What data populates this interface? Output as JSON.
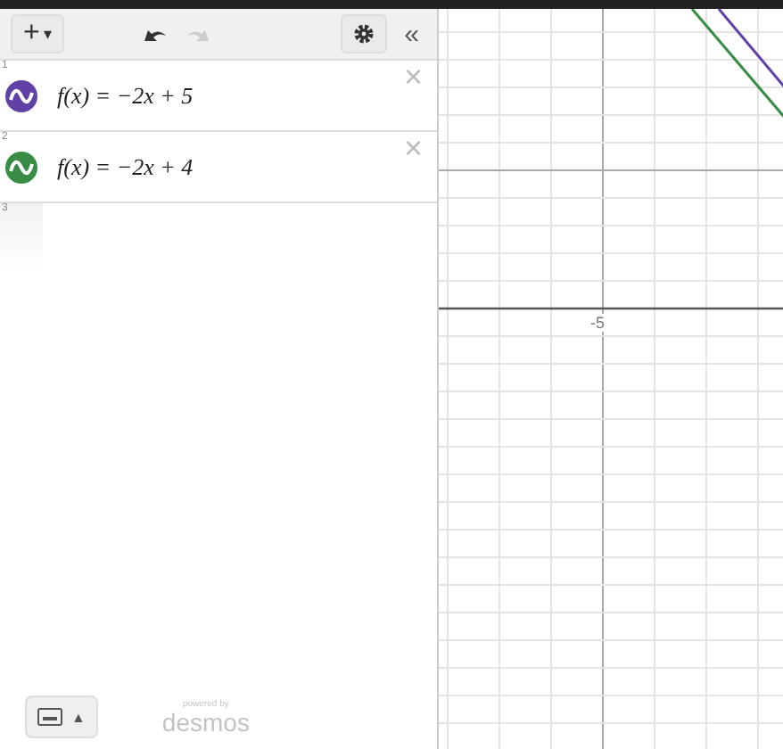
{
  "toolbar": {
    "add": "+",
    "add_caret": "▾",
    "collapse": "«"
  },
  "expressions": [
    {
      "index": "1",
      "formula": "f(x) = −2x + 5",
      "color": "#6042a6",
      "delete": "×"
    },
    {
      "index": "2",
      "formula": "f(x) = −2x + 4",
      "color": "#388c46",
      "delete": "×"
    },
    {
      "index": "3"
    }
  ],
  "footer": {
    "keypad_caret": "▲",
    "powered_by": "powered by",
    "brand": "desmos"
  },
  "graph": {
    "axis_label": "-5"
  }
}
